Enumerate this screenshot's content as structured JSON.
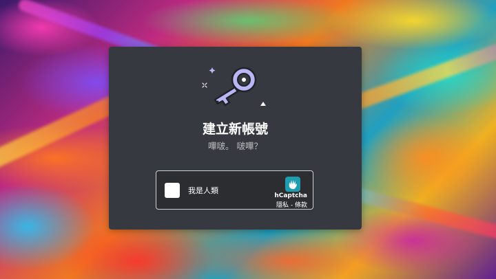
{
  "modal": {
    "title": "建立新帳號",
    "subtitle": "嗶啵。 啵嗶？"
  },
  "captcha": {
    "label": "我是人類",
    "brand": "hCaptcha",
    "privacy_link": "隱私",
    "separator": " - ",
    "terms_link": "條款"
  },
  "icons": {
    "illustration": "key-icon",
    "captcha_logo": "hcaptcha-hand-icon"
  },
  "colors": {
    "modal_bg": "#36393f",
    "accent_purple": "#b9b6f5",
    "text_secondary": "#b9bbbe"
  }
}
